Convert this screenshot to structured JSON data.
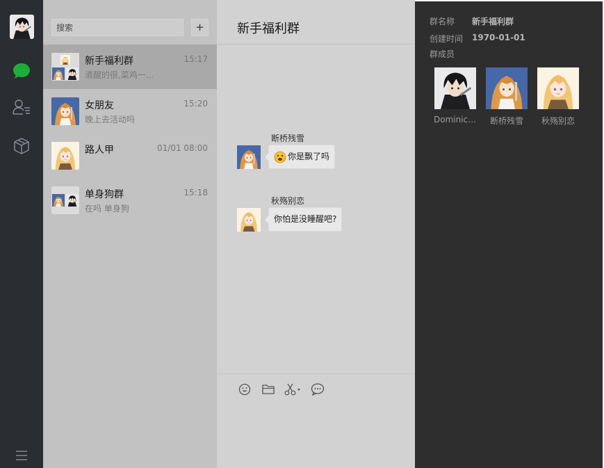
{
  "search": {
    "placeholder": "搜索",
    "add_label": "+"
  },
  "nav": {
    "items": [
      {
        "name": "chat",
        "icon": "chat-bubble-icon",
        "active_color": "#1fad3a"
      },
      {
        "name": "contacts",
        "icon": "contacts-icon"
      },
      {
        "name": "favorites",
        "icon": "box-icon"
      },
      {
        "name": "menu",
        "icon": "menu-icon"
      }
    ]
  },
  "chats": [
    {
      "name": "新手福利群",
      "time": "15:17",
      "preview": "清醒的很,菜鸡一群..."
    },
    {
      "name": "女朋友",
      "time": "15:20",
      "preview": "晚上去活动吗"
    },
    {
      "name": "路人甲",
      "time": "01/01 08:00",
      "preview": ""
    },
    {
      "name": "单身狗群",
      "time": "15:18",
      "preview": "在吗 单身狗"
    }
  ],
  "conversation": {
    "title": "新手福利群",
    "messages": [
      {
        "sender": "断桥残雪",
        "text": "你是飘了吗",
        "emoji": "emoji-face-icon"
      },
      {
        "sender": "秋殇别恋",
        "text": "你怕是没睡醒吧?"
      }
    ],
    "tools": [
      "smile-icon",
      "folder-icon",
      "scissors-icon",
      "chat-bubble-outline-icon"
    ]
  },
  "group_info": {
    "name_label": "群名称",
    "name_value": "新手福利群",
    "created_label": "创建时间",
    "created_value": "1970-01-01",
    "members_label": "群成员",
    "members": [
      {
        "name": "Dominick..."
      },
      {
        "name": "断桥残雪"
      },
      {
        "name": "秋殇别恋"
      }
    ]
  },
  "colors": {
    "rail": "#2a2d31",
    "list_bg": "#c2c2c2",
    "list_active": "#a9a9a9",
    "conv_bg": "#d2d2d2",
    "info_bg": "#2e2e2e",
    "accent": "#1fad3a"
  }
}
